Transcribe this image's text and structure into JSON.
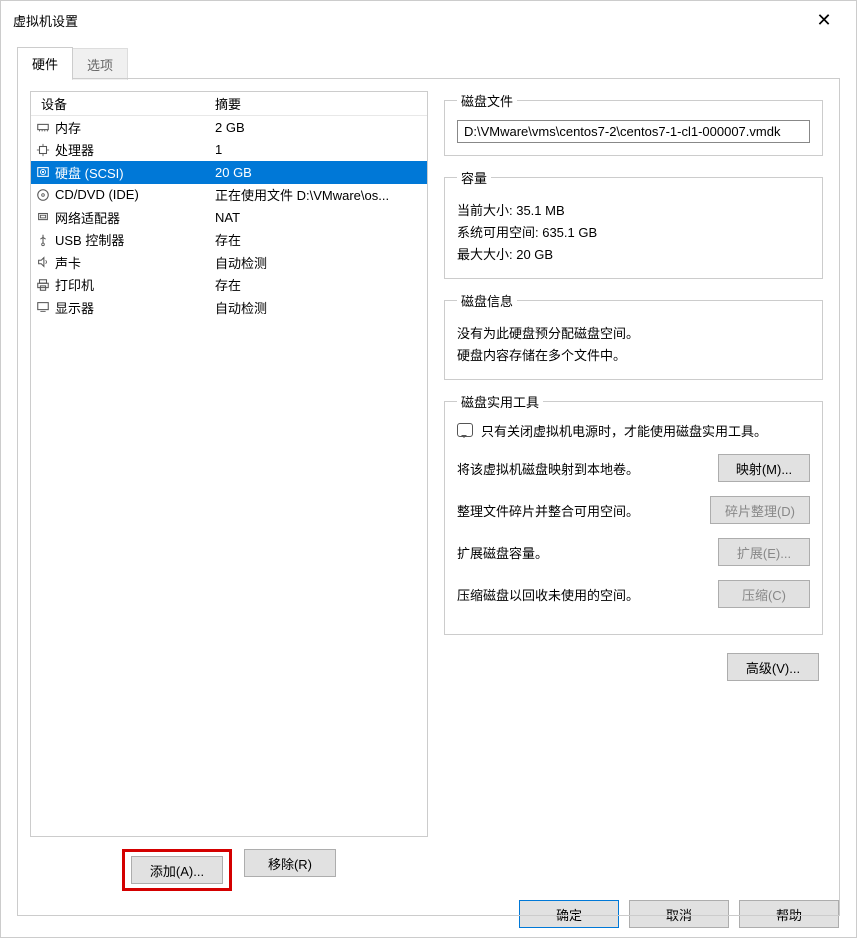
{
  "window_title": "虚拟机设置",
  "tabs": {
    "hardware": "硬件",
    "options": "选项"
  },
  "columns": {
    "device": "设备",
    "summary": "摘要"
  },
  "hw": [
    {
      "name": "内存",
      "summary": "2 GB",
      "icon": "memory",
      "selected": false
    },
    {
      "name": "处理器",
      "summary": "1",
      "icon": "cpu",
      "selected": false
    },
    {
      "name": "硬盘 (SCSI)",
      "summary": "20 GB",
      "icon": "hdd",
      "selected": true
    },
    {
      "name": "CD/DVD (IDE)",
      "summary": "正在使用文件 D:\\VMware\\os...",
      "icon": "cd",
      "selected": false
    },
    {
      "name": "网络适配器",
      "summary": "NAT",
      "icon": "net",
      "selected": false
    },
    {
      "name": "USB 控制器",
      "summary": "存在",
      "icon": "usb",
      "selected": false
    },
    {
      "name": "声卡",
      "summary": "自动检测",
      "icon": "sound",
      "selected": false
    },
    {
      "name": "打印机",
      "summary": "存在",
      "icon": "printer",
      "selected": false
    },
    {
      "name": "显示器",
      "summary": "自动检测",
      "icon": "display",
      "selected": false
    }
  ],
  "buttons": {
    "add": "添加(A)...",
    "remove": "移除(R)"
  },
  "disk_file": {
    "legend": "磁盘文件",
    "value": "D:\\VMware\\vms\\centos7-2\\centos7-1-cl1-000007.vmdk"
  },
  "capacity": {
    "legend": "容量",
    "current": "当前大小: 35.1 MB",
    "free": "系统可用空间: 635.1 GB",
    "max": "最大大小: 20 GB"
  },
  "disk_info": {
    "legend": "磁盘信息",
    "line1": "没有为此硬盘预分配磁盘空间。",
    "line2": "硬盘内容存储在多个文件中。"
  },
  "utilities": {
    "legend": "磁盘实用工具",
    "banner": "只有关闭虚拟机电源时，才能使用磁盘实用工具。",
    "map_text": "将该虚拟机磁盘映射到本地卷。",
    "map_btn": "映射(M)...",
    "defrag_text": "整理文件碎片并整合可用空间。",
    "defrag_btn": "碎片整理(D)",
    "expand_text": "扩展磁盘容量。",
    "expand_btn": "扩展(E)...",
    "compact_text": "压缩磁盘以回收未使用的空间。",
    "compact_btn": "压缩(C)"
  },
  "advanced_btn": "高级(V)...",
  "footer": {
    "ok": "确定",
    "cancel": "取消",
    "help": "帮助"
  }
}
